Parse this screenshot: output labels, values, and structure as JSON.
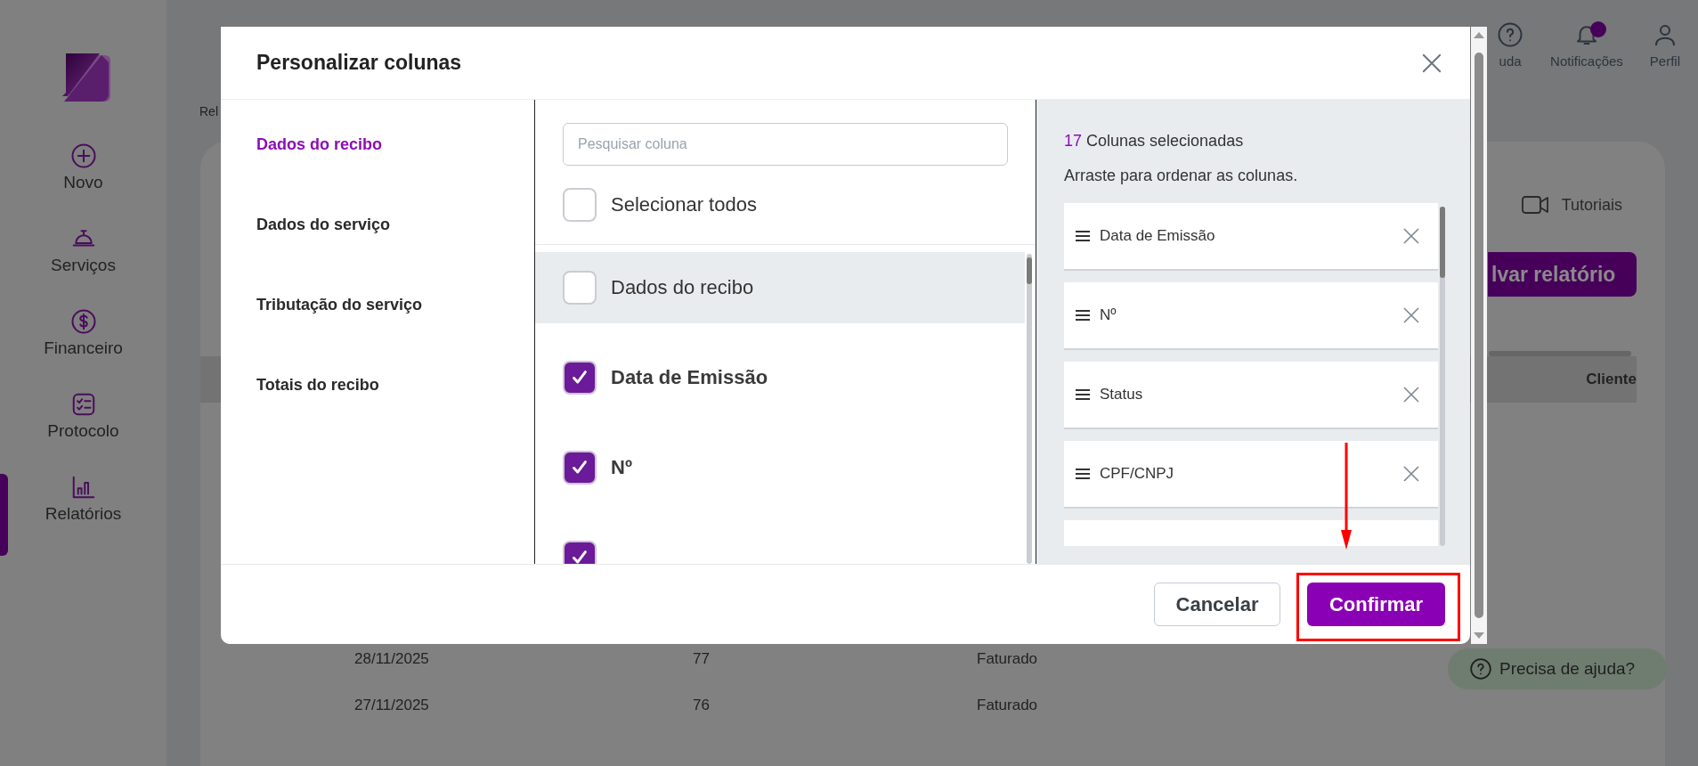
{
  "sidebar": {
    "items": [
      {
        "label": "Novo",
        "kind": "plus",
        "selected": false
      },
      {
        "label": "Serviços",
        "kind": "servicebell",
        "selected": false
      },
      {
        "label": "Financeiro",
        "kind": "dollar",
        "selected": false
      },
      {
        "label": "Protocolo",
        "kind": "checklist",
        "selected": false
      },
      {
        "label": "Relatórios",
        "kind": "chart",
        "selected": true
      }
    ]
  },
  "header": {
    "actions": [
      {
        "label": "uda",
        "kind": "help",
        "badge": false
      },
      {
        "label": "Notificações",
        "kind": "bell",
        "badge": true
      },
      {
        "label": "Perfil",
        "kind": "user",
        "badge": false
      }
    ]
  },
  "breadcrumb": "Rel",
  "toolbar": {
    "tutorials": "Tutoriais",
    "save_button": "lvar relatório"
  },
  "table": {
    "header": "Cliente",
    "rows": [
      [
        "28/11/2025",
        "77",
        "Faturado"
      ],
      [
        "27/11/2025",
        "76",
        "Faturado"
      ]
    ]
  },
  "help_button": "Precisa de ajuda?",
  "modal": {
    "title": "Personalizar colunas",
    "categories": [
      {
        "label": "Dados do recibo",
        "selected": true
      },
      {
        "label": "Dados do serviço",
        "selected": false
      },
      {
        "label": "Tributação do serviço",
        "selected": false
      },
      {
        "label": "Totais do recibo",
        "selected": false
      }
    ],
    "search": {
      "placeholder": "Pesquisar coluna"
    },
    "select_all": {
      "label": "Selecionar todos",
      "checked": false
    },
    "options": [
      {
        "kind": "group",
        "label": "Dados do recibo",
        "checked": false
      },
      {
        "kind": "item",
        "label": "Data de Emissão",
        "checked": true
      },
      {
        "kind": "item",
        "label": "Nº",
        "checked": true
      },
      {
        "kind": "cut",
        "checked": true
      }
    ],
    "selected_count": "17",
    "selected_label": "Colunas selecionadas",
    "hint": "Arraste para ordenar as colunas.",
    "columns": [
      {
        "kind": "column",
        "label": "Data de Emissão"
      },
      {
        "kind": "column",
        "label": "Nº"
      },
      {
        "kind": "column",
        "label": "Status"
      },
      {
        "kind": "column",
        "label": "CPF/CNPJ"
      },
      {
        "kind": "cut"
      }
    ],
    "buttons": [
      {
        "label": "Cancelar",
        "kind": "secondary"
      },
      {
        "label": "Confirmar",
        "kind": "primary"
      }
    ]
  }
}
